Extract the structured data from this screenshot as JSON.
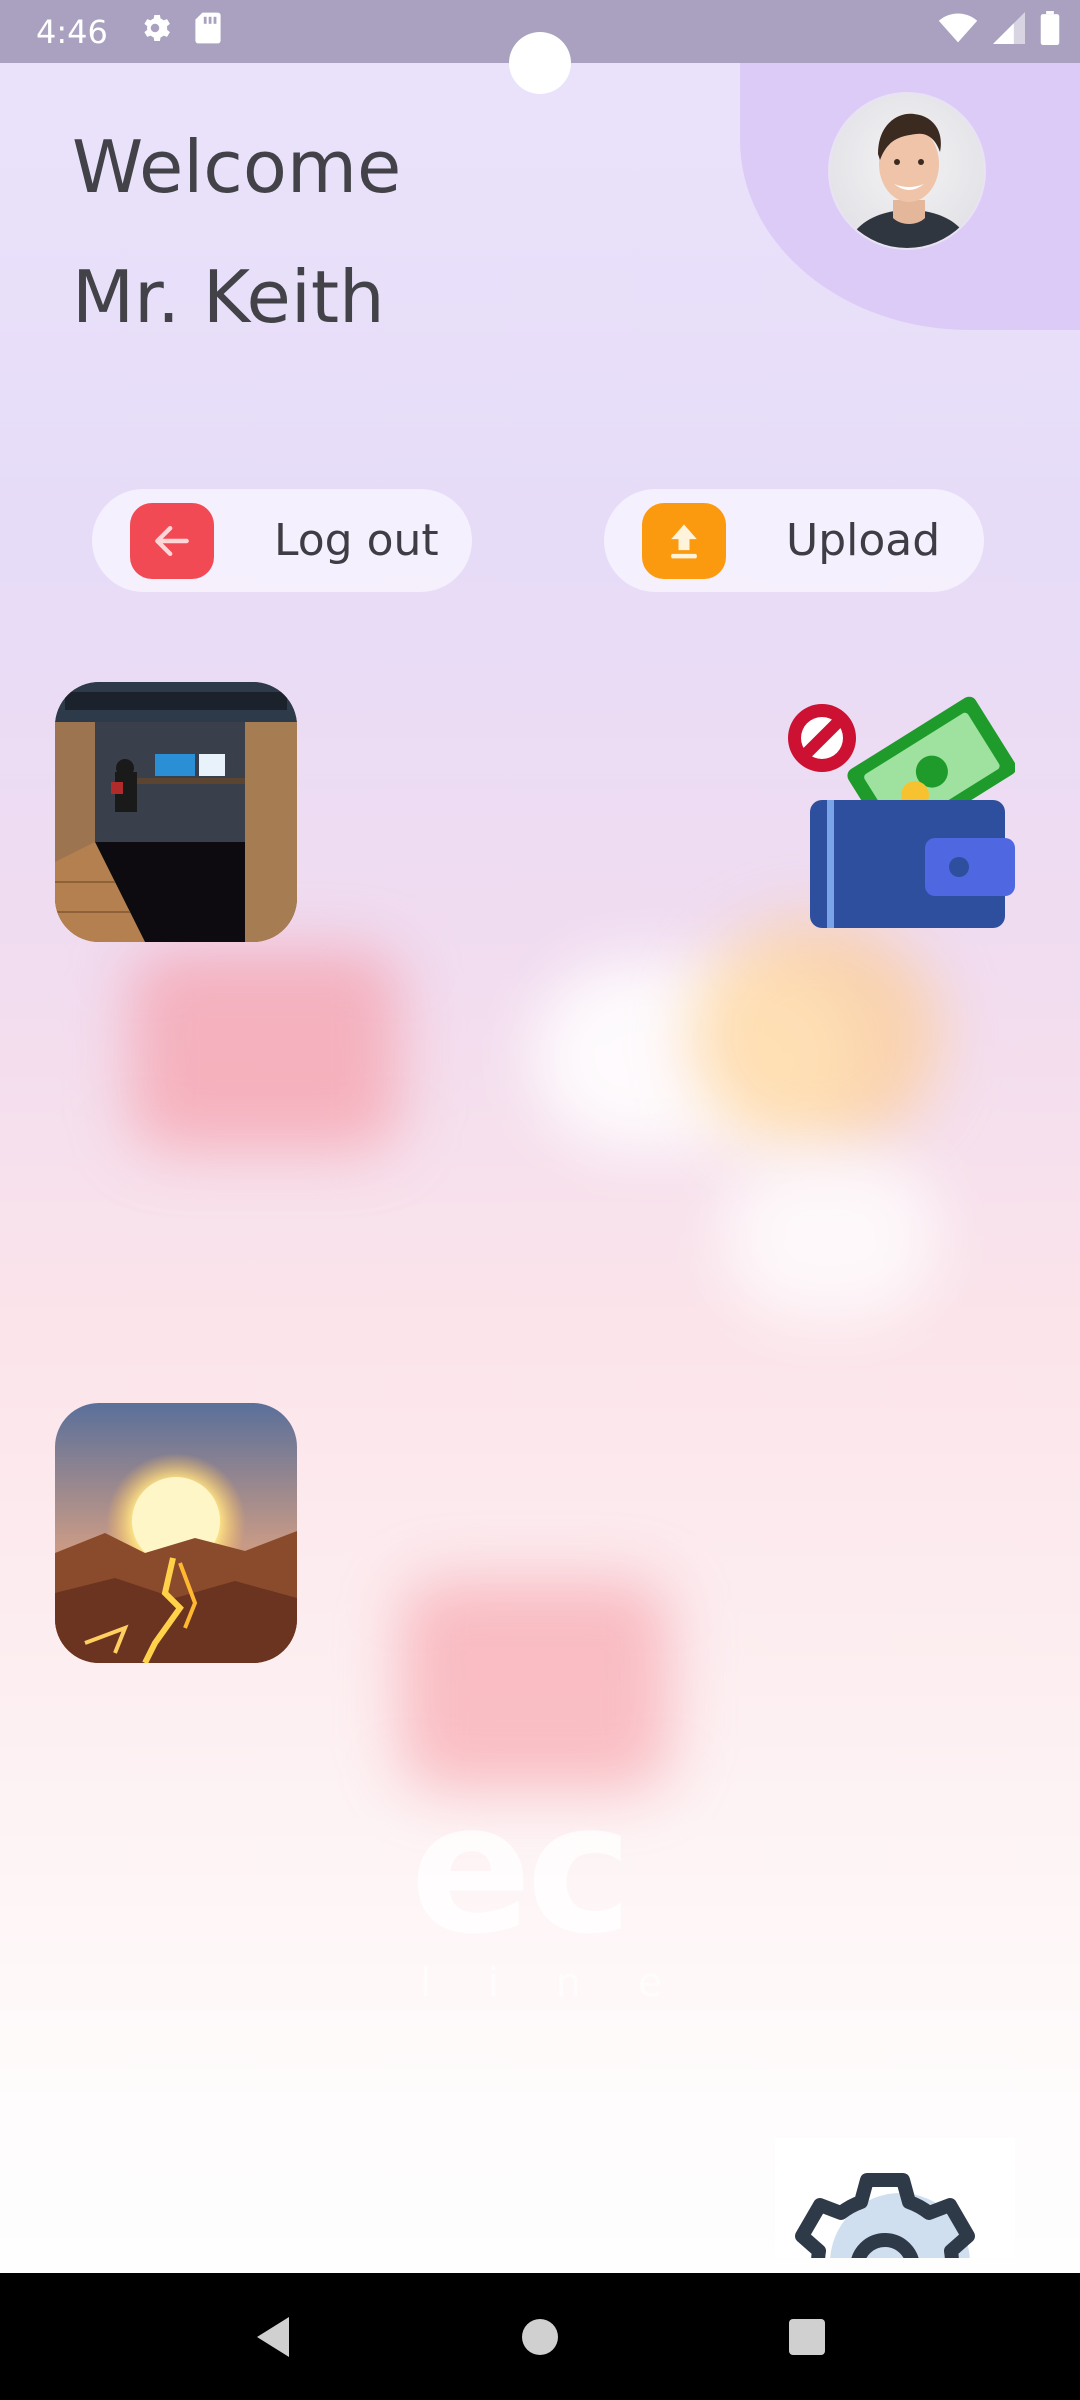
{
  "status_bar": {
    "time": "4:46",
    "icons_left": [
      "settings-icon",
      "sd-card-icon"
    ],
    "icons_right": [
      "wifi-icon",
      "signal-icon",
      "battery-icon"
    ]
  },
  "header": {
    "welcome": "Welcome",
    "user_name": "Mr. Keith",
    "avatar": "profile-avatar"
  },
  "actions": {
    "logout_label": "Log out",
    "upload_label": "Upload"
  },
  "content": {
    "items": [
      "room-photo",
      "wallet-blocked-illustration",
      "sunset-photo"
    ]
  },
  "watermark": {
    "text": "ec",
    "subtext": "l i n e  g"
  },
  "colors": {
    "logout_accent": "#f24a55",
    "upload_accent": "#fb9a0e",
    "text_primary": "#424248"
  },
  "nav": [
    "back",
    "home",
    "recents"
  ]
}
